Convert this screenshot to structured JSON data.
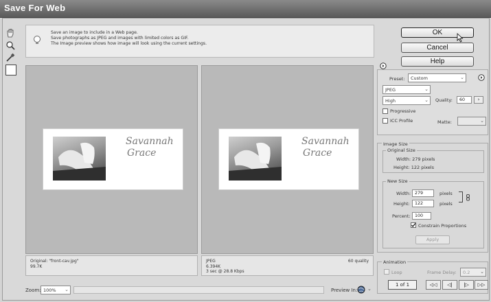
{
  "window": {
    "title": "Save For Web"
  },
  "tools": [
    "hand-tool-icon",
    "zoom-tool-icon",
    "eyedropper-tool-icon"
  ],
  "tip": {
    "lines": [
      "Save an image to include in a Web page.",
      "Save photographs as JPEG and images with limited colors as GIF.",
      "The Image preview shows how image will look using the current settings."
    ]
  },
  "preview_card": {
    "line1": "Savannah",
    "line2": "Grace"
  },
  "original_info": {
    "name": "Original: \"front-cav.jpg\"",
    "size": "99.7K"
  },
  "optimized_info": {
    "format": "JPEG",
    "size": "6.394K",
    "time": "3 sec @ 28.8 Kbps",
    "quality": "60 quality"
  },
  "zoom": {
    "label": "Zoom:",
    "value": "100%"
  },
  "preview_in": {
    "label": "Preview In:"
  },
  "buttons": {
    "ok": "OK",
    "cancel": "Cancel",
    "help": "Help"
  },
  "settings": {
    "preset_label": "Preset:",
    "preset_value": "Custom",
    "format_value": "JPEG",
    "compression_value": "High",
    "quality_label": "Quality:",
    "quality_value": "60",
    "progressive_label": "Progressive",
    "icc_label": "ICC Profile",
    "matte_label": "Matte:"
  },
  "image_size": {
    "group_label": "Image Size",
    "original_label": "Original Size",
    "orig_width": "Width: 279 pixels",
    "orig_height": "Height: 122 pixels",
    "new_label": "New Size",
    "width_label": "Width:",
    "width_value": "279",
    "width_unit": "pixels",
    "height_label": "Height:",
    "height_value": "122",
    "height_unit": "pixels",
    "percent_label": "Percent:",
    "percent_value": "100",
    "constrain_label": "Constrain Proportions",
    "apply_label": "Apply"
  },
  "animation": {
    "group_label": "Animation",
    "loop_label": "Loop",
    "frame_delay_label": "Frame Delay:",
    "frame_delay_value": "0.2",
    "frame_counter": "1 of 1",
    "nav": [
      "◁◁",
      "◁|",
      "|▷",
      "▷▷"
    ]
  }
}
